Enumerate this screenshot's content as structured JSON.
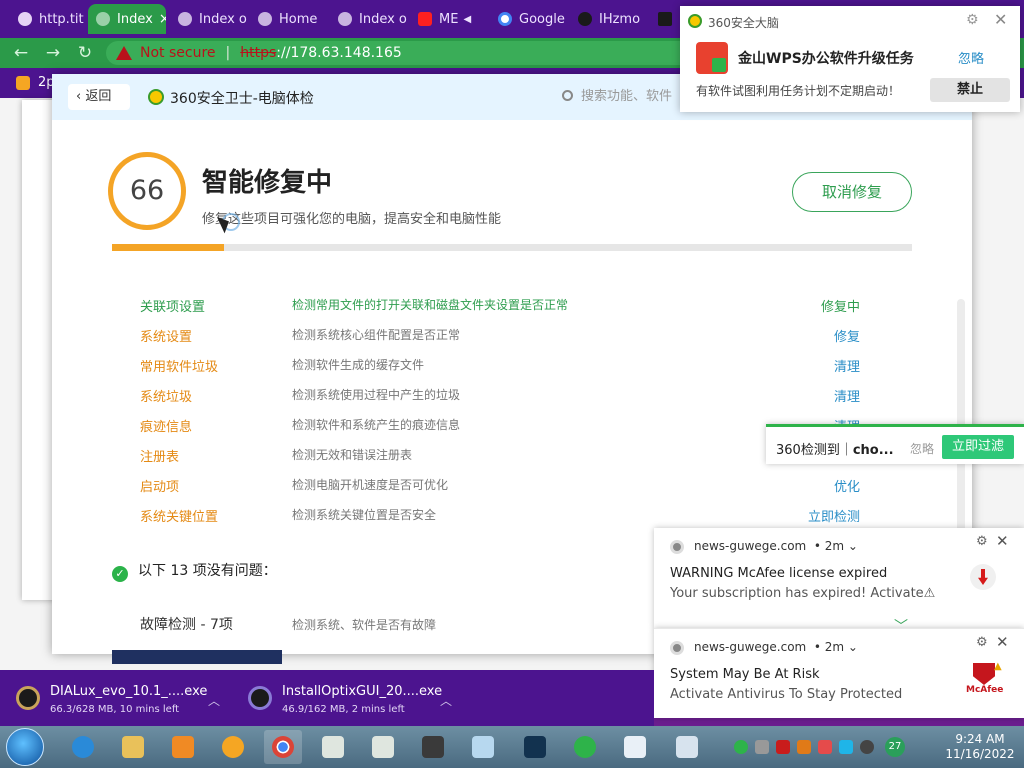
{
  "browser": {
    "tabs": [
      {
        "label": "http.tit",
        "active": false
      },
      {
        "label": "Index",
        "active": true
      },
      {
        "label": "Index o",
        "active": false
      },
      {
        "label": "Home",
        "active": false
      },
      {
        "label": "Index o",
        "active": false
      },
      {
        "label": "ME",
        "active": false
      },
      {
        "label": "Google",
        "active": false
      },
      {
        "label": "IHzmo",
        "active": false
      }
    ],
    "active_tab_close": "×",
    "not_secure_label": "Not secure",
    "url_scheme": "https",
    "url_rest": "://178.63.148.165",
    "bookmark_label": "2p"
  },
  "app360": {
    "back_label": "返回",
    "title": "360安全卫士-电脑体检",
    "search_placeholder": "搜索功能、软件",
    "score": "66",
    "headline": "智能修复中",
    "subline": "修复这些项目可强化您的电脑，提高安全和电脑性能",
    "cancel_label": "取消修复",
    "progress_percent": 14,
    "items": [
      {
        "name": "关联项设置",
        "desc": "检测常用文件的打开关联和磁盘文件夹设置是否正常",
        "action": "修复中",
        "active": true
      },
      {
        "name": "系统设置",
        "desc": "检测系统核心组件配置是否正常",
        "action": "修复",
        "active": false
      },
      {
        "name": "常用软件垃圾",
        "desc": "检测软件生成的缓存文件",
        "action": "清理",
        "active": false
      },
      {
        "name": "系统垃圾",
        "desc": "检测系统使用过程中产生的垃圾",
        "action": "清理",
        "active": false
      },
      {
        "name": "痕迹信息",
        "desc": "检测软件和系统产生的痕迹信息",
        "action": "清理",
        "active": false
      },
      {
        "name": "注册表",
        "desc": "检测无效和错误注册表",
        "action": "",
        "active": false
      },
      {
        "name": "启动项",
        "desc": "检测电脑开机速度是否可优化",
        "action": "优化",
        "active": false
      },
      {
        "name": "系统关键位置",
        "desc": "检测系统关键位置是否安全",
        "action": "立即检测",
        "active": false
      }
    ],
    "ok_heading": "以下 13 项没有问题：",
    "ok_group": "故障检测 - 7项",
    "ok_group_desc": "检测系统、软件是否有故障"
  },
  "notif360": {
    "header": "360安全大脑",
    "title": "金山WPS办公软件升级任务",
    "ignore_label": "忽略",
    "body": "有软件试图利用任务计划不定期启动！",
    "ban_label": "禁止"
  },
  "side_alert": {
    "prefix": "360检测到｜",
    "target": "cho...",
    "ignore_label": "忽略",
    "button_label": "立即过滤"
  },
  "push_notifications": [
    {
      "source": "news-guwege.com",
      "age": "• 2m ⌄",
      "title": "WARNING McAfee license expired",
      "body": "Your subscription has expired! Activate⚠"
    },
    {
      "source": "news-guwege.com",
      "age": "• 2m ⌄",
      "title": "System May Be At Risk",
      "body": "Activate Antivirus To Stay Protected",
      "brand": "McAfee"
    }
  ],
  "downloads": [
    {
      "name": "DIALux_evo_10.1_....exe",
      "status": "66.3/628 MB, 10 mins left"
    },
    {
      "name": "InstallOptixGUI_20....exe",
      "status": "46.9/162 MB, 2 mins left"
    }
  ],
  "taskbar": {
    "tray_badge": "27",
    "time": "9:24 AM",
    "date": "11/16/2022"
  }
}
